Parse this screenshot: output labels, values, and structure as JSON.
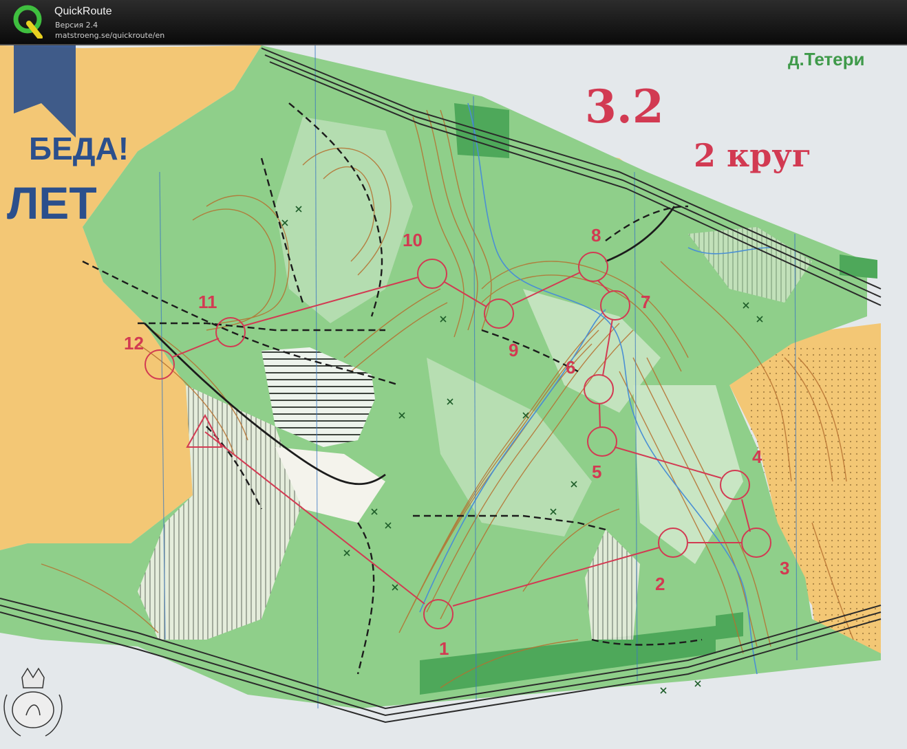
{
  "app": {
    "title": "QuickRoute",
    "version": "Версия 2.4",
    "url": "matstroeng.se/quickroute/en",
    "logo_icon": "quickroute-q-logo"
  },
  "map": {
    "course_title": "3.2",
    "course_subtitle": "2 круг",
    "village_label": "д.Тетери",
    "poster_texts": [
      "БЕДА!",
      "ЛЕТ"
    ],
    "course_color": "#d23a52",
    "start_marker": "start-triangle",
    "controls": [
      {
        "number": "1"
      },
      {
        "number": "2"
      },
      {
        "number": "3"
      },
      {
        "number": "4"
      },
      {
        "number": "5"
      },
      {
        "number": "6"
      },
      {
        "number": "7"
      },
      {
        "number": "8"
      },
      {
        "number": "9"
      },
      {
        "number": "10"
      },
      {
        "number": "11"
      },
      {
        "number": "12"
      }
    ],
    "colors": {
      "forest": "#8fcf8a",
      "open_land": "#f3c775",
      "dense_forest": "#4ea85a",
      "contours": "#b5702f",
      "water": "#4a8fd4"
    }
  }
}
